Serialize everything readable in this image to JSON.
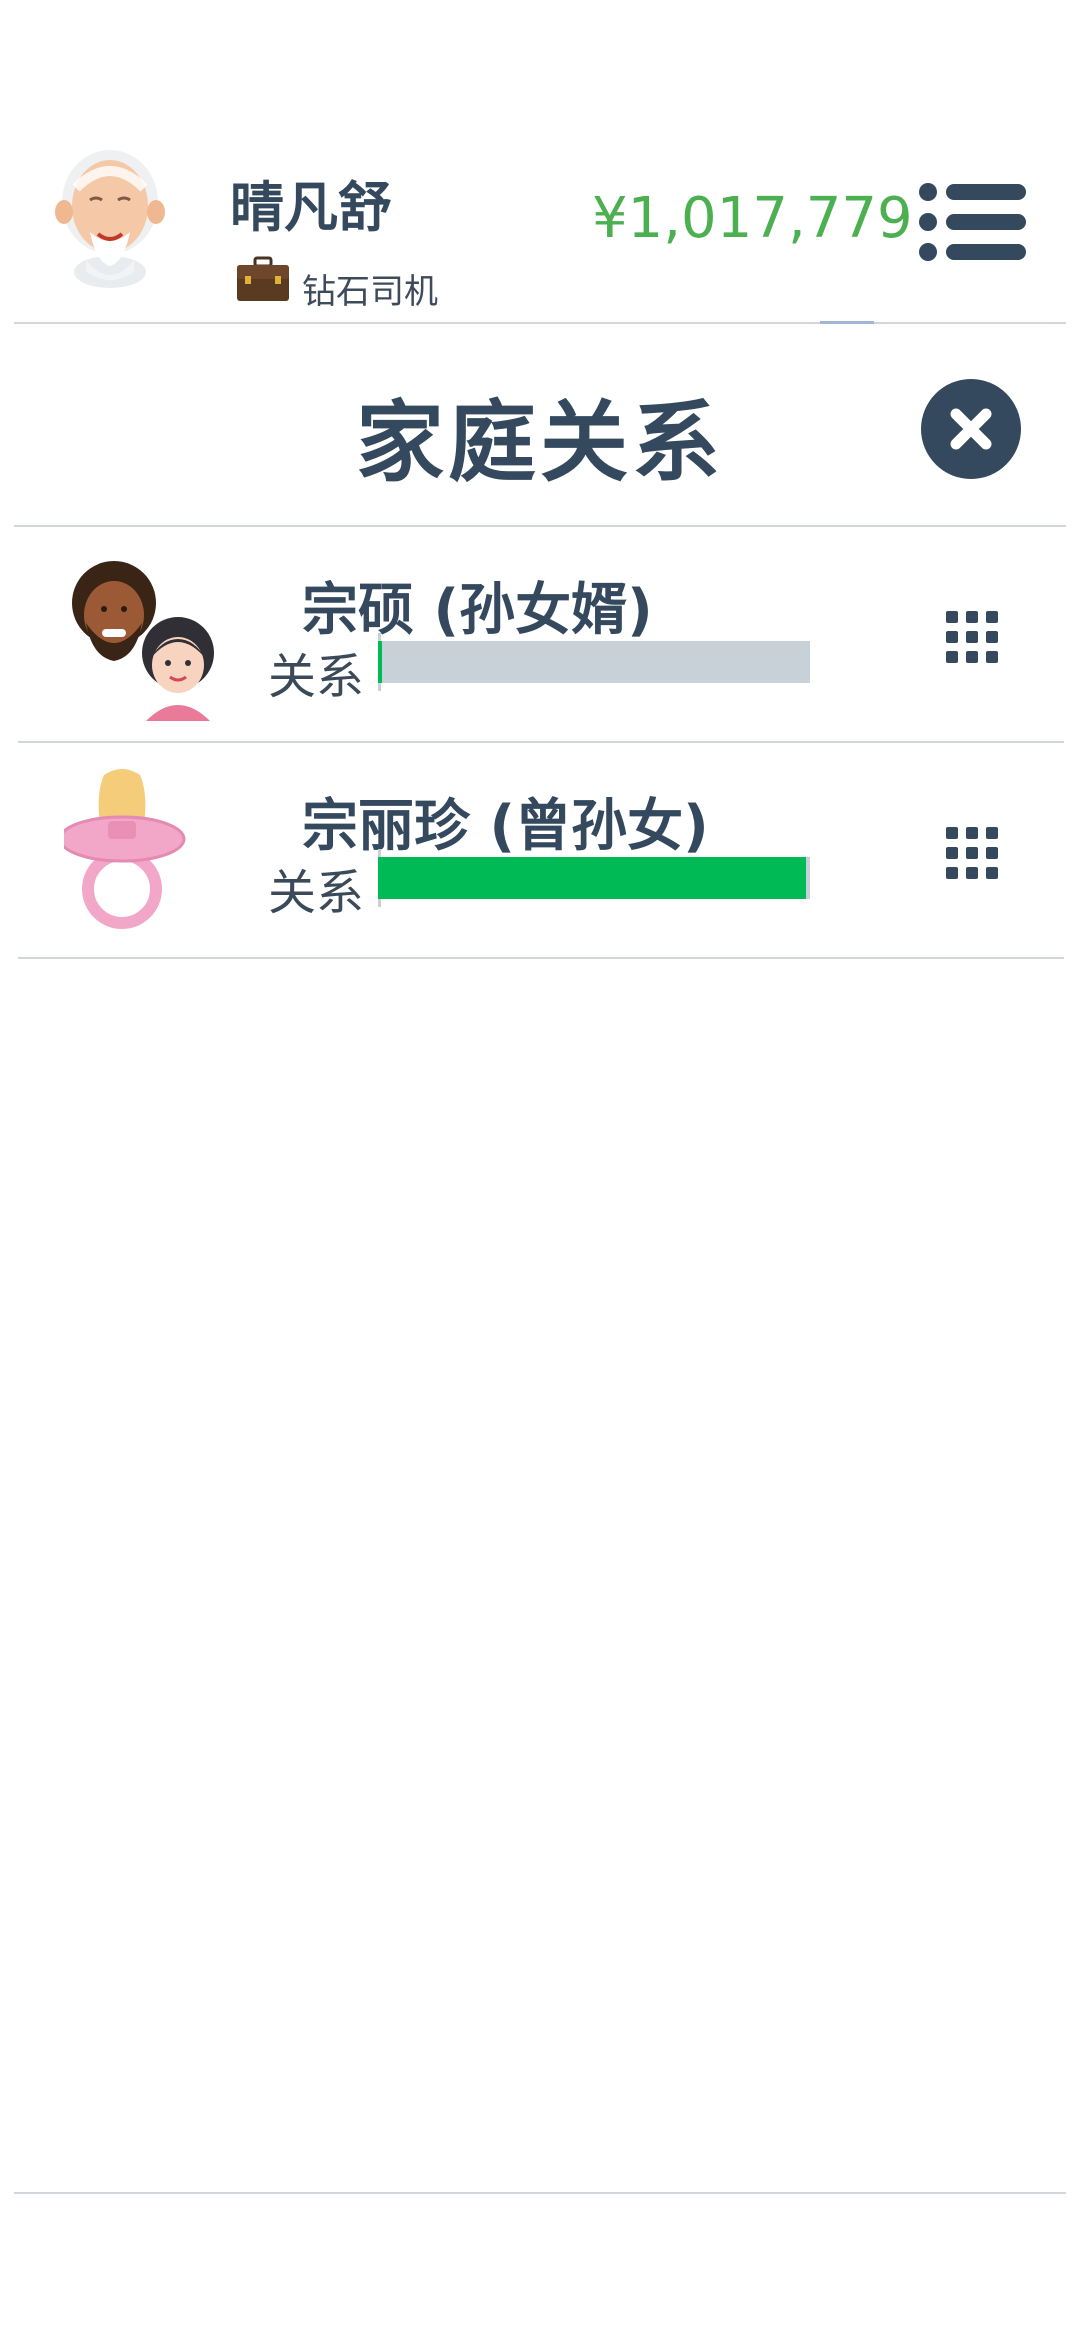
{
  "header": {
    "player_name": "晴凡舒",
    "job_title": "钻石司机",
    "money": "¥1,017,779",
    "avatar_icon": "elderly-man-avatar-icon",
    "job_icon": "briefcase-icon",
    "menu_icon": "list-menu-icon"
  },
  "section": {
    "title": "家庭关系",
    "close_icon": "close-icon"
  },
  "relations": [
    {
      "name": "宗硕 (孙女婿)",
      "relation_label": "关系",
      "relation_level": 0.01,
      "avatar_icon": "couple-avatar-icon",
      "options_icon": "grid-icon"
    },
    {
      "name": "宗丽珍 (曾孙女)",
      "relation_label": "关系",
      "relation_level": 0.99,
      "avatar_icon": "pacifier-icon",
      "options_icon": "grid-icon"
    }
  ],
  "colors": {
    "text": "#34495e",
    "money": "#4caf50",
    "bar_fill": "#00bb55",
    "bar_track": "#c8d0d8",
    "close_bg": "#34495e"
  }
}
